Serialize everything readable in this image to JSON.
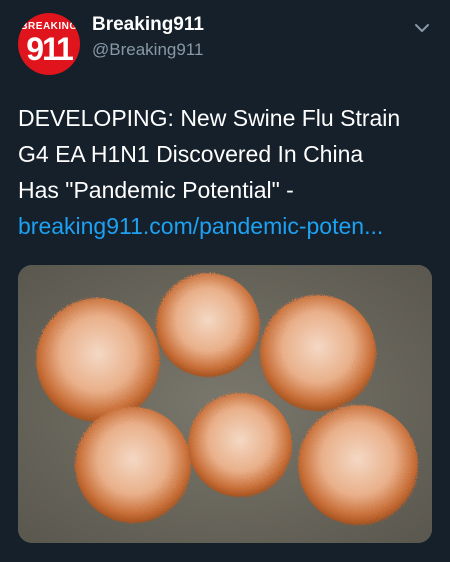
{
  "account": {
    "avatar_top": "BREAKING",
    "avatar_number": "911",
    "display_name": "Breaking911",
    "handle": "@Breaking911"
  },
  "tweet": {
    "lines": [
      "DEVELOPING: New Swine Flu Strain",
      "G4 EA H1N1 Discovered In China",
      "Has \"Pandemic Potential\" -"
    ],
    "link_text": "breaking911.com/pandemic-poten..."
  },
  "icons": {
    "menu": "chevron-down-icon",
    "media": "virus-micrograph"
  },
  "colors": {
    "background": "#15202b",
    "link": "#1da1f2",
    "handle": "#8899a6",
    "avatar": "#e0141c"
  }
}
